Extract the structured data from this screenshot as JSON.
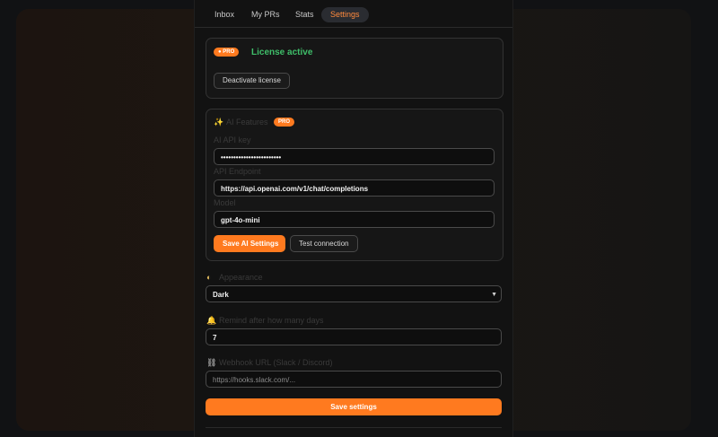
{
  "tabs": [
    "Inbox",
    "My PRs",
    "Stats",
    "Settings"
  ],
  "license": {
    "badge": "PRO",
    "status": "License active",
    "deactivate_label": "Deactivate license"
  },
  "ai": {
    "title": "AI Features",
    "badge": "PRO",
    "api_key_label": "AI API key",
    "api_key_value": "••••••••••••••••••••••••",
    "endpoint_label": "API Endpoint",
    "endpoint_value": "https://api.openai.com/v1/chat/completions",
    "model_label": "Model",
    "model_value": "gpt-4o-mini",
    "save_label": "Save AI Settings",
    "test_label": "Test connection"
  },
  "appearance": {
    "label": "Appearance",
    "selected": "Dark"
  },
  "reminders": {
    "label": "Remind after how many days",
    "value": "7"
  },
  "webhook": {
    "label": "Webhook URL (Slack / Discord)",
    "placeholder": "https://hooks.slack.com/..."
  },
  "save_settings_label": "Save settings",
  "colors": {
    "accent": "#ff7a1f",
    "success": "#3fbf6a",
    "active_tab": "#ff8a3d"
  }
}
